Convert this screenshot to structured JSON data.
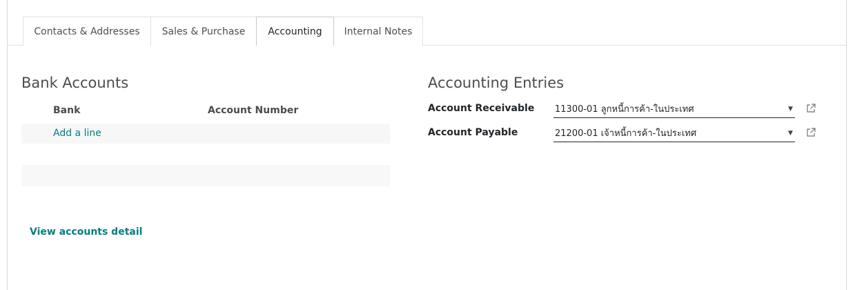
{
  "tabs": [
    {
      "label": "Contacts & Addresses"
    },
    {
      "label": "Sales & Purchase"
    },
    {
      "label": "Accounting"
    },
    {
      "label": "Internal Notes"
    }
  ],
  "bank": {
    "title": "Bank Accounts",
    "columns": [
      "Bank",
      "Account Number"
    ],
    "add_line": "Add a line",
    "view_detail": "View accounts detail"
  },
  "entries": {
    "title": "Accounting Entries",
    "receivable_label": "Account Receivable",
    "receivable_value": "11300-01 ลูกหนี้การค้า-ในประเทศ",
    "payable_label": "Account Payable",
    "payable_value": "21200-01 เจ้าหนี้การค้า-ในประเทศ"
  },
  "colors": {
    "link": "#017e84"
  }
}
